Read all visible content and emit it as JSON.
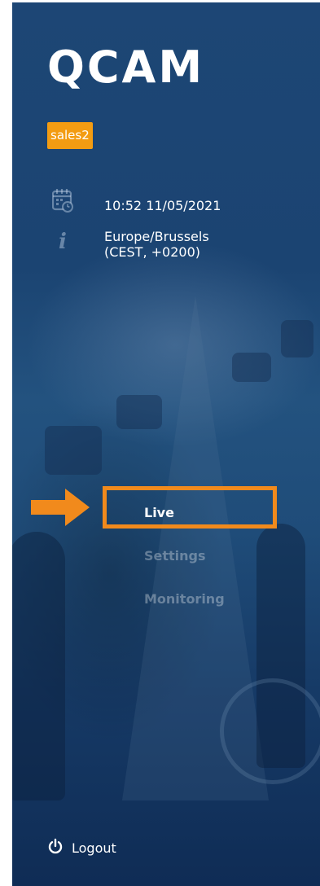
{
  "app": {
    "title": "QCAM",
    "user": "sales2"
  },
  "info": {
    "datetime": "10:52 11/05/2021",
    "timezone": "Europe/Brussels\n(CEST, +0200)",
    "datetime_icon": "calendar-clock-icon",
    "timezone_icon": "info-icon"
  },
  "nav": {
    "items": [
      {
        "label": "Live",
        "active": true
      },
      {
        "label": "Settings",
        "active": false
      },
      {
        "label": "Monitoring",
        "active": false
      }
    ]
  },
  "footer": {
    "logout_label": "Logout",
    "logout_icon": "power-icon"
  },
  "colors": {
    "sidebar_bg": "#1b4472",
    "accent_orange": "#f39c12",
    "highlight_orange": "#f18a1c",
    "text": "#ffffff",
    "muted_nav": "rgba(255,255,255,0.32)"
  }
}
